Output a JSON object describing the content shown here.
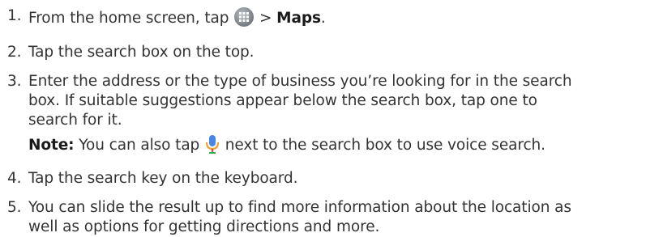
{
  "steps": [
    {
      "num": "1.",
      "before_icon": "From the home screen, tap",
      "icon": "apps-grid-icon",
      "sep": " > ",
      "bold": "Maps",
      "after": "."
    },
    {
      "num": "2.",
      "text": "Tap the search box on the top."
    },
    {
      "num": "3.",
      "line1": "Enter the address or the type of business you’re looking for in the search",
      "line2": "box. If suitable suggestions appear below the search box, tap one to",
      "line3": "search for it.",
      "note_label": "Note:",
      "note_before_icon": "You can also tap",
      "note_icon": "microphone-icon",
      "note_after": "next to the search box to use voice search."
    },
    {
      "num": "4.",
      "text": "Tap the search key on the keyboard."
    },
    {
      "num": "5.",
      "line1": "You can slide the result up to find more information about the location as",
      "line2": "well as options for getting directions and more."
    }
  ],
  "colors": {
    "text": "#333333",
    "apps_icon_bg": "#8a8f96",
    "mic_blue": "#4a86e8",
    "mic_stand": "#f0a030"
  }
}
